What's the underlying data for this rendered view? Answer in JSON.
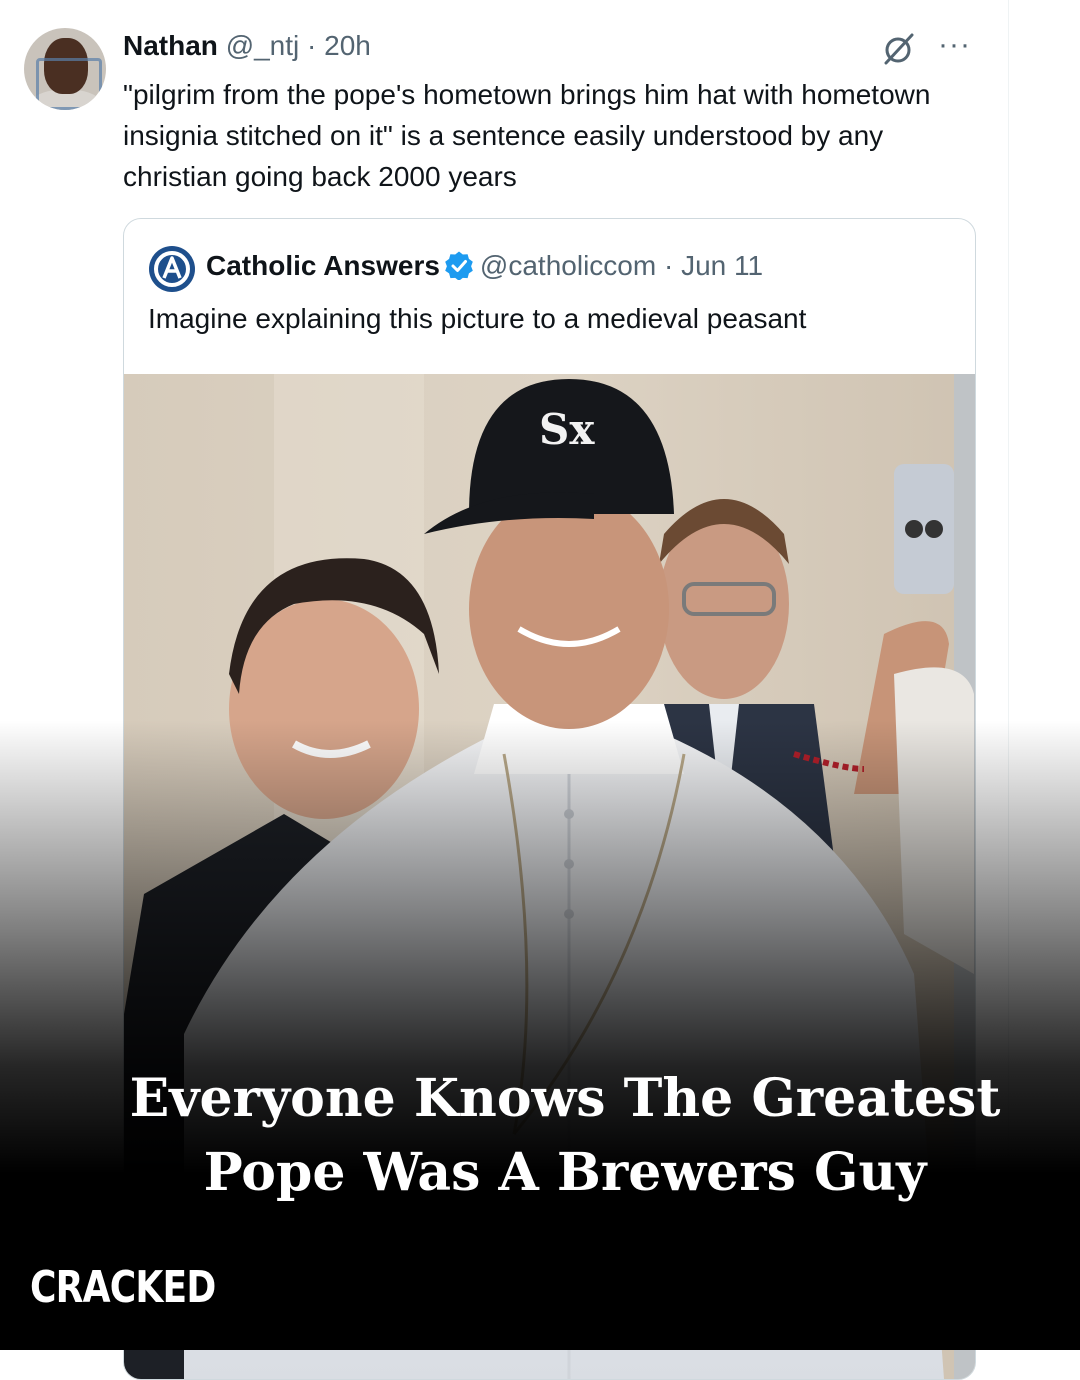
{
  "tweet": {
    "author_name": "Nathan",
    "author_handle": "@_ntj",
    "separator": "·",
    "time": "20h",
    "text": "\"pilgrim from the pope's hometown brings him hat with hometown insignia stitched on it\" is a sentence easily understood by any christian going back 2000 years",
    "more_label": "···",
    "icons": {
      "avatar": "avatar-photo",
      "brand": "slashed-circle-icon",
      "more": "more-dots-icon"
    }
  },
  "quoted_tweet": {
    "author_name": "Catholic Answers",
    "author_handle": "@catholiccom",
    "separator": "·",
    "date": "Jun 11",
    "text": "Imagine explaining this picture to a medieval peasant",
    "verified": true,
    "icons": {
      "logo": "catholic-answers-logo",
      "verified": "verified-badge-icon"
    }
  },
  "overlay": {
    "headline_line1": "Everyone Knows The Greatest",
    "headline_line2": "Pope Was A Brewers Guy",
    "brand": "CRACKED"
  },
  "colors": {
    "text_primary": "#0f1419",
    "text_secondary": "#536471",
    "border": "#cfd9de",
    "verified_blue": "#1d9bf0",
    "logo_blue": "#1e4f8c"
  }
}
